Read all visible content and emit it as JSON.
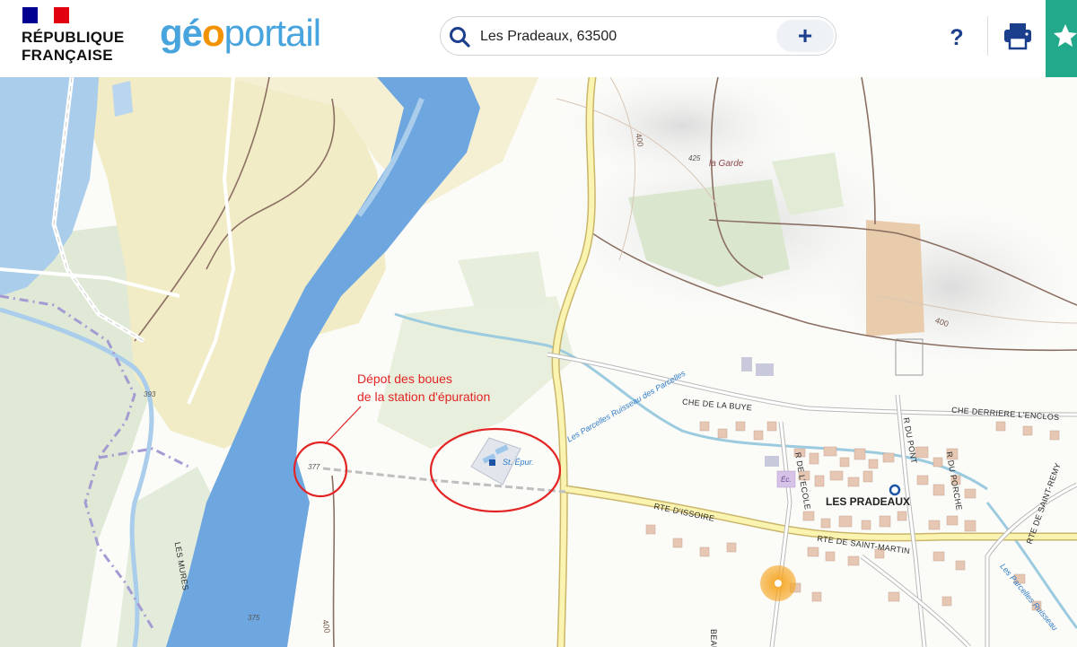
{
  "header": {
    "republic_line1": "RÉPUBLIQUE",
    "republic_line2": "FRANÇAISE",
    "brand": {
      "part1": "gé",
      "part2": "o",
      "part3": "portail"
    },
    "search": {
      "value": "Les Pradeaux, 63500",
      "add_label": "+"
    },
    "help_label": "?"
  },
  "map": {
    "annotation": {
      "line1": "Dépot des boues",
      "line2": "de la station d'épuration"
    },
    "labels": {
      "la_garde": "la Garde",
      "la_garde_alt": "425",
      "contour_400_a": "400",
      "contour_400_b": "400",
      "contour_400_c": "400",
      "station": "St. Épur.",
      "spot_377": "377",
      "spot_393": "393",
      "spot_375": "375",
      "che_buye": "CHE DE LA BUYE",
      "che_derriere": "CHE DERRIERE L'ENCLOS",
      "rue_pont": "R DU PONT",
      "rte_issoire": "RTE D'ISSOIRE",
      "rte_saint_martin": "RTE DE SAINT-MARTIN",
      "rte_saint_remy": "RTE DE SAINT-REMY",
      "rue_ecole": "R DE L'ECOLE",
      "rue_porche": "R DU PORCHE",
      "les_pradeaux": "LES PRADEAUX",
      "ecole": "Éc.",
      "les_mures": "LES MURES",
      "ruisseau_1": "Les Parcelles Ruisseau des Parcelles",
      "ruisseau_2": "Les Parcelles Ruisseau",
      "beaufort": "BEAUFORT"
    }
  },
  "colors": {
    "river": "#6ea6e0",
    "water_label": "#2e7bc8",
    "brand_blue": "#47a4dd",
    "brand_orange": "#f29200",
    "accent_navy": "#1b3e8d",
    "favorite_green": "#22a98c",
    "annotation_red": "#e32424"
  }
}
